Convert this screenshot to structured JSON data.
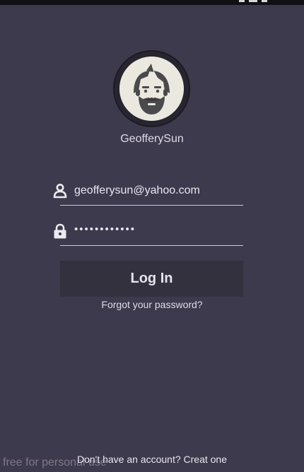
{
  "profile": {
    "username": "GeofferySun",
    "avatar_icon": "bearded-man-avatar-icon"
  },
  "form": {
    "email_value": "geofferysun@yahoo.com",
    "email_icon": "user-icon",
    "password_value": "••••••••••••",
    "password_icon": "lock-icon"
  },
  "actions": {
    "login_label": "Log In",
    "forgot_label": "Forgot your password?",
    "signup_label": "Don't have an account? Creat one"
  },
  "watermark": "free for personal use",
  "colors": {
    "background": "#3e3a4d",
    "button": "#34313f",
    "text": "#e4e2ea"
  }
}
